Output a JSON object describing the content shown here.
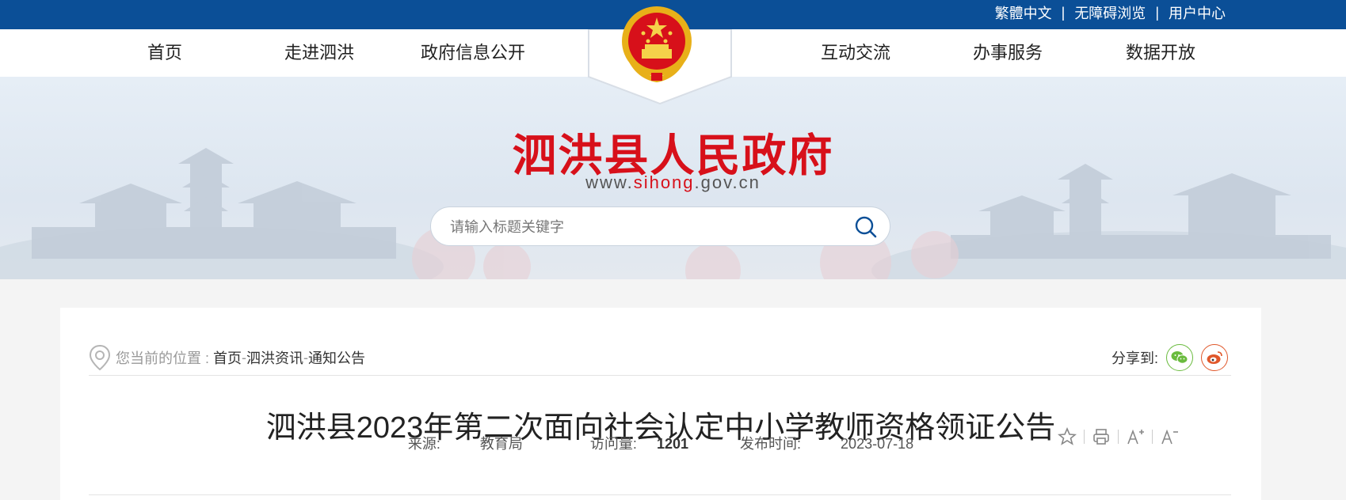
{
  "topbar": {
    "links": [
      "繁體中文",
      "无障碍浏览",
      "用户中心"
    ],
    "separator": "|"
  },
  "nav": {
    "left": [
      "首页",
      "走进泗洪",
      "政府信息公开"
    ],
    "right": [
      "互动交流",
      "办事服务",
      "数据开放"
    ]
  },
  "header": {
    "site_title": "泗洪县人民政府",
    "url_prefix": "www.",
    "url_highlight": "sihong",
    "url_suffix": ".gov.cn",
    "emblem_icon": "national-emblem-icon"
  },
  "search": {
    "placeholder": "请输入标题关键字",
    "icon": "search-icon"
  },
  "breadcrumb": {
    "prefix": "您当前的位置 :",
    "items": [
      "首页",
      "泗洪资讯",
      "通知公告"
    ],
    "separator": "-"
  },
  "share": {
    "label": "分享到:",
    "icons": [
      "wechat-icon",
      "weibo-icon"
    ]
  },
  "article": {
    "title": "泗洪县2023年第二次面向社会认定中小学教师资格领证公告",
    "source_label": "来源:",
    "source_value": "教育局",
    "views_label": "访问量:",
    "views_value": "1201",
    "date_label": "发布时间:",
    "date_value": "2023-07-18"
  },
  "tools": [
    "star-icon",
    "print-icon",
    "font-increase-icon",
    "font-decrease-icon"
  ],
  "colors": {
    "topbar": "#0b4f97",
    "brand_red": "#d7101a",
    "wechat": "#6abb3e",
    "weibo": "#e0572a"
  }
}
